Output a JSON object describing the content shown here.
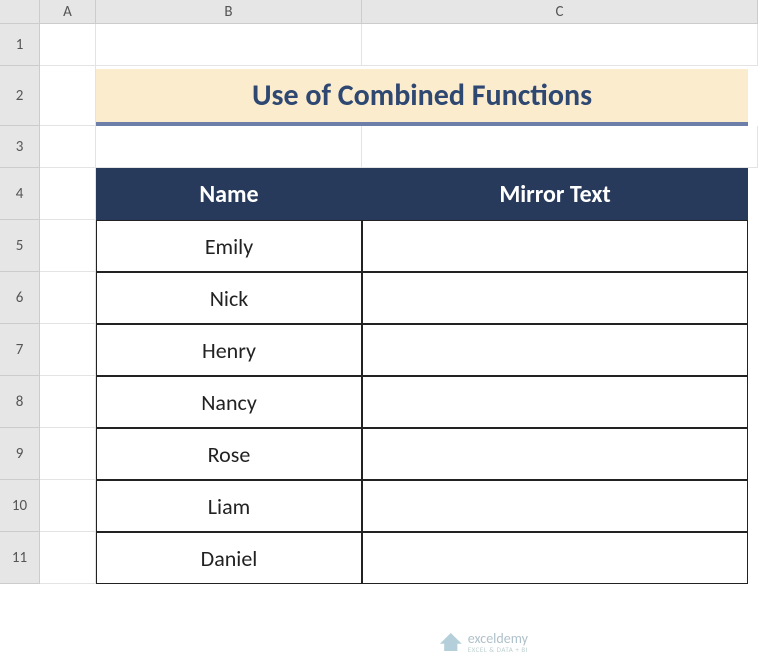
{
  "columns": [
    "",
    "A",
    "B",
    "C"
  ],
  "rows": [
    "1",
    "2",
    "3",
    "4",
    "5",
    "6",
    "7",
    "8",
    "9",
    "10",
    "11"
  ],
  "title": "Use of Combined Functions",
  "headers": {
    "name": "Name",
    "mirror": "Mirror Text"
  },
  "data": [
    {
      "name": "Emily",
      "mirror": ""
    },
    {
      "name": "Nick",
      "mirror": ""
    },
    {
      "name": "Henry",
      "mirror": ""
    },
    {
      "name": "Nancy",
      "mirror": ""
    },
    {
      "name": "Rose",
      "mirror": ""
    },
    {
      "name": "Liam",
      "mirror": ""
    },
    {
      "name": "Daniel",
      "mirror": ""
    }
  ],
  "watermark": {
    "brand": "exceldemy",
    "tag": "EXCEL & DATA + BI"
  }
}
